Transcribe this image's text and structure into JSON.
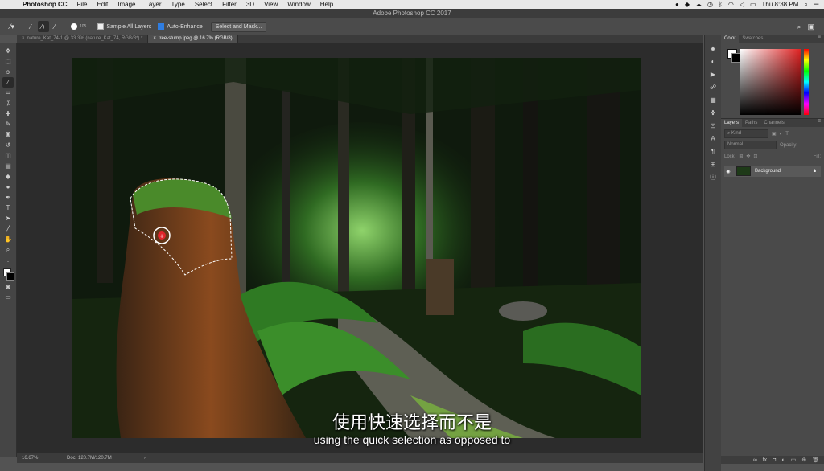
{
  "menubar": {
    "app_name": "Photoshop CC",
    "items": [
      "File",
      "Edit",
      "Image",
      "Layer",
      "Type",
      "Select",
      "Filter",
      "3D",
      "View",
      "Window",
      "Help"
    ],
    "clock": "Thu 8:38 PM"
  },
  "titlebar": {
    "title": "Adobe Photoshop CC 2017"
  },
  "options": {
    "brush_size": "105",
    "sample_all_layers_label": "Sample All Layers",
    "sample_all_layers_checked": false,
    "auto_enhance_label": "Auto-Enhance",
    "auto_enhance_checked": true,
    "select_mask_label": "Select and Mask..."
  },
  "tabs": [
    {
      "label": "nature_Kat_74-1 @ 33.3% (nature_Kat_74, RGB/8*) *",
      "active": false
    },
    {
      "label": "tree-stump.jpeg @ 16.7% (RGB/8)",
      "active": true
    }
  ],
  "status": {
    "zoom": "16.67%",
    "doc": "Doc: 120.7M/120.7M"
  },
  "subtitles": {
    "chinese": "使用快速选择而不是",
    "english": "using the quick selection as opposed to"
  },
  "color_panel": {
    "tabs": [
      "Color",
      "Swatches"
    ]
  },
  "layers_panel": {
    "tabs": [
      "Layers",
      "Paths",
      "Channels"
    ],
    "kind_placeholder": "Kind",
    "mode": "Normal",
    "opacity_label": "Opacity:",
    "lock_label": "Lock:",
    "fill_label": "Fill:",
    "layers": [
      {
        "name": "Background",
        "locked": true
      }
    ]
  },
  "colors": {
    "accent": "#2f7de1",
    "panel_bg": "#4a4a4a",
    "canvas_bg": "#2c2c2c"
  }
}
